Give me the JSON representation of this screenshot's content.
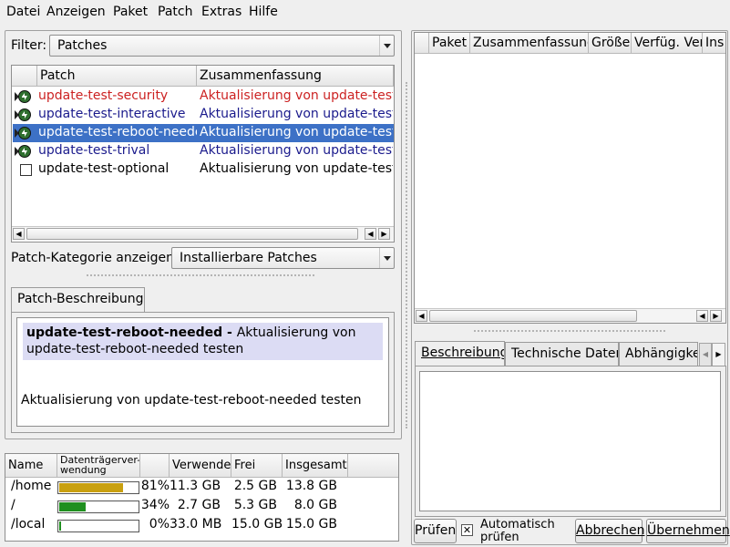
{
  "menu": [
    "Datei",
    "Anzeigen",
    "Paket",
    "Patch",
    "Extras",
    "Hilfe"
  ],
  "filter": {
    "label": "Filter:",
    "value": "Patches"
  },
  "patch_table": {
    "columns": [
      "Patch",
      "Zusammenfassung"
    ],
    "rows": [
      {
        "name": "update-test-security",
        "summary": "Aktualisierung von update-test-s",
        "color": "#cc2222",
        "status": "update",
        "selected": false
      },
      {
        "name": "update-test-interactive",
        "summary": "Aktualisierung von update-test-in",
        "color": "#1a1a8c",
        "status": "update",
        "selected": false
      },
      {
        "name": "update-test-reboot-needed",
        "summary": "Aktualisierung von update-test-re",
        "color": "#ffffff",
        "status": "update",
        "selected": true
      },
      {
        "name": "update-test-trival",
        "summary": "Aktualisierung von update-test-tri",
        "color": "#1a1a8c",
        "status": "update",
        "selected": false
      },
      {
        "name": "update-test-optional",
        "summary": "Aktualisierung von update-test-o",
        "color": "#000000",
        "status": "checkbox",
        "selected": false
      }
    ]
  },
  "category": {
    "label": "Patch-Kategorie anzeigen:",
    "value": "Installierbare Patches"
  },
  "description": {
    "tab": "Patch-Beschreibung",
    "title": "update-test-reboot-needed",
    "title_sep": " - ",
    "summary_first": "Aktualisierung von",
    "summary_second": "update-test-reboot-needed testen",
    "body": "Aktualisierung von update-test-reboot-needed testen"
  },
  "disk": {
    "columns": [
      "Name",
      "Datenträgerver-wendung",
      "Verwendet",
      "Frei",
      "Insgesamt"
    ],
    "header_line1": "Datenträgerver-",
    "header_line2": "wendung",
    "rows": [
      {
        "name": "/home",
        "usage": 0.81,
        "percent": "81%",
        "used": "11.3 GB",
        "free": "2.5 GB",
        "total": "13.8 GB",
        "color": "#c9a010"
      },
      {
        "name": "/",
        "usage": 0.34,
        "percent": "34%",
        "used": "2.7 GB",
        "free": "5.3 GB",
        "total": "8.0 GB",
        "color": "#1f8f1f"
      },
      {
        "name": "/local",
        "usage": 0.0,
        "percent": "0%",
        "used": "33.0 MB",
        "free": "15.0 GB",
        "total": "15.0 GB",
        "color": "#1f8f1f"
      }
    ]
  },
  "package_table": {
    "columns": [
      "Paket",
      "Zusammenfassung",
      "Größe",
      "Verfüg. Ver.",
      "Ins"
    ]
  },
  "detail_tabs": [
    "Beschreibung",
    "Technische Daten",
    "Abhängigke"
  ],
  "buttons": {
    "check": "Prüfen",
    "auto_check_line1": "Automatisch",
    "auto_check_line2": "prüfen",
    "cancel": "Abbrechen",
    "accept": "Übernehmen"
  }
}
